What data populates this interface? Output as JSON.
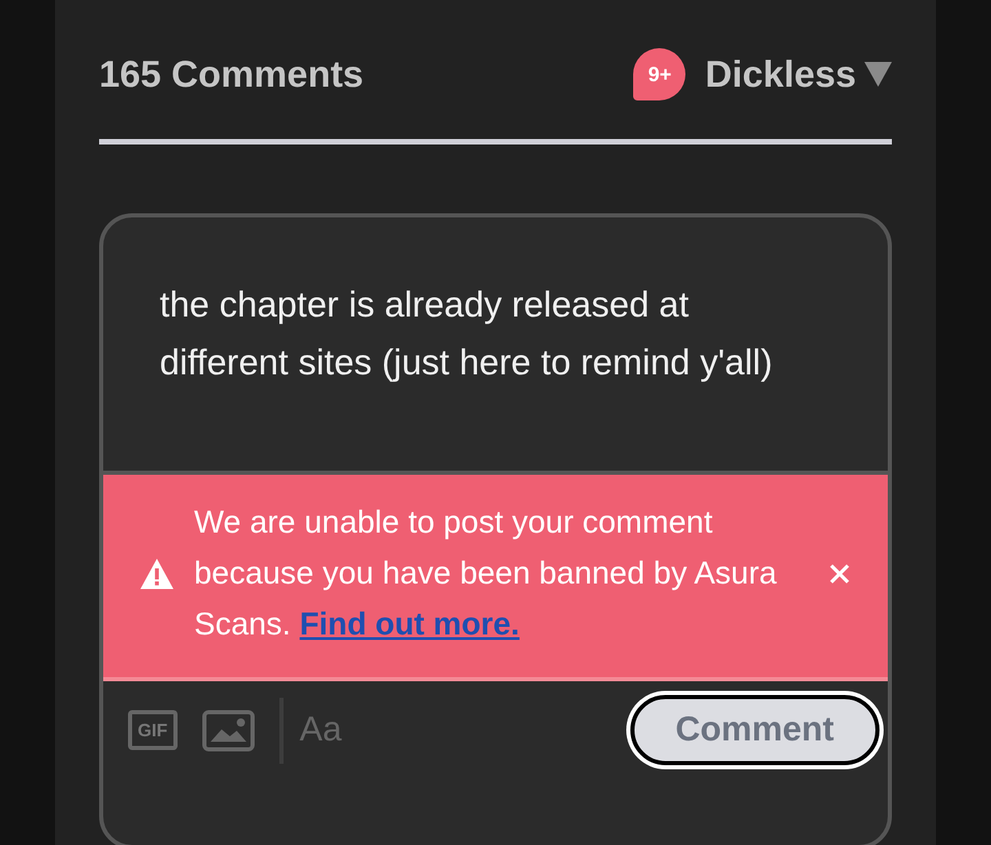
{
  "header": {
    "comment_count": "165 Comments",
    "notification_badge": "9+",
    "user_name": "Dickless"
  },
  "editor": {
    "value": "the chapter is already released at different sites (just here to remind y'all)"
  },
  "alert": {
    "message": "We are unable to post your comment because you have been banned by Asura Scans.",
    "link": "Find out more."
  },
  "toolbar": {
    "gif_label": "GIF",
    "format_label": "Aa",
    "submit": "Comment"
  }
}
